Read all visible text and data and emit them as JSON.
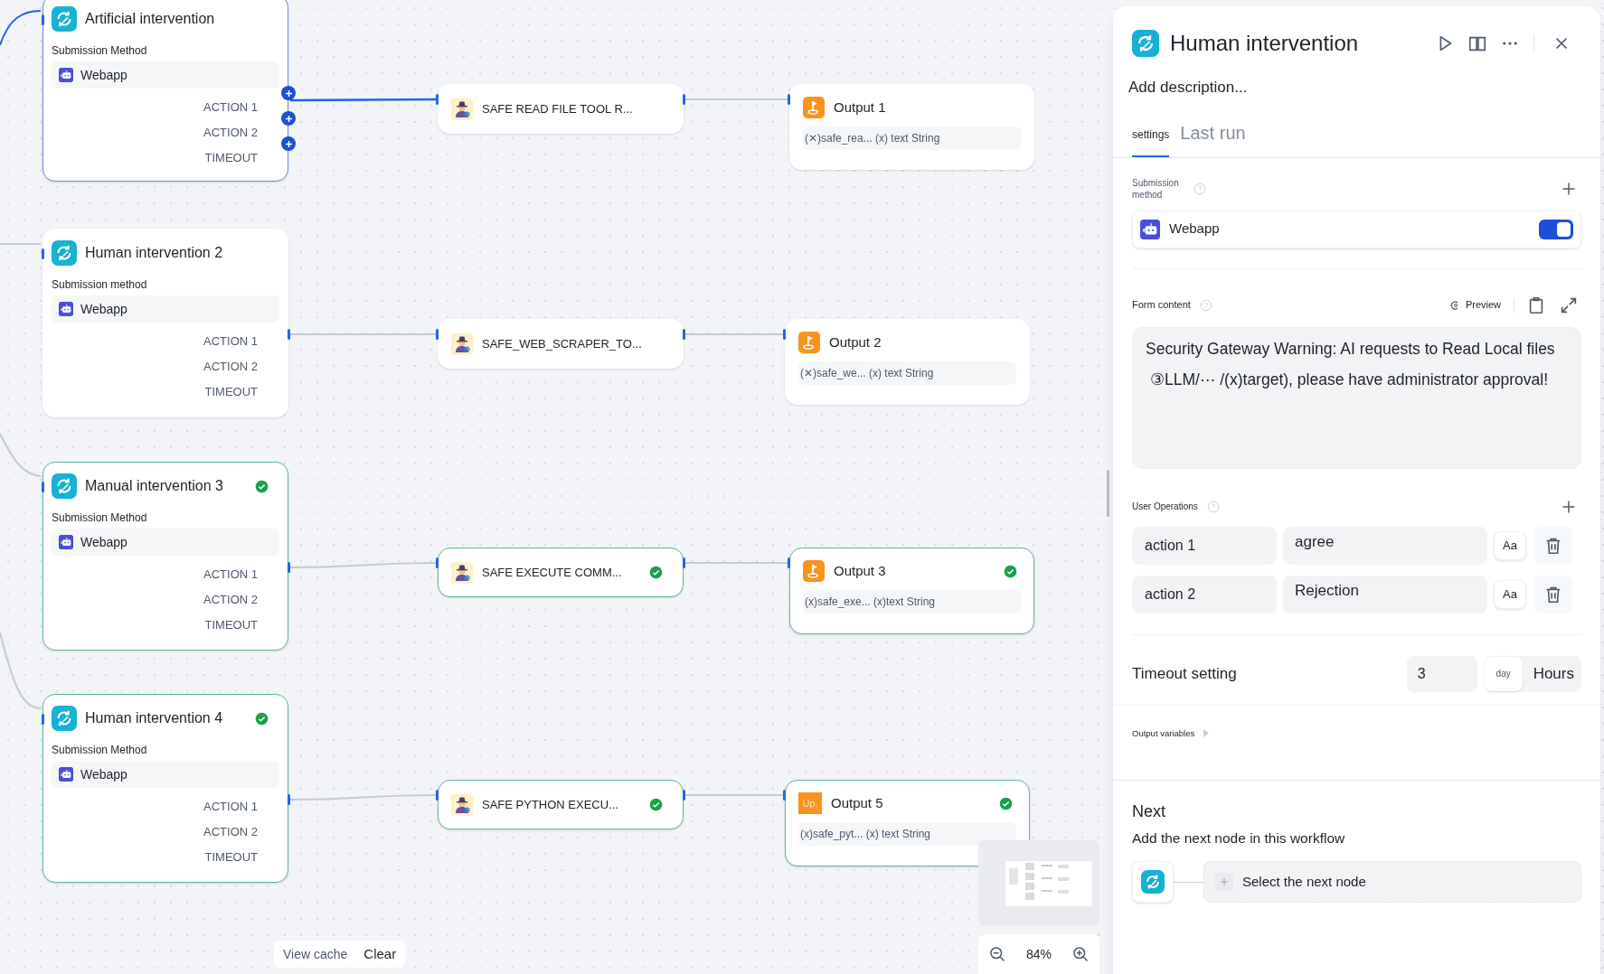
{
  "canvas": {
    "human_nodes": [
      {
        "title": "Artificial intervention",
        "selected": true,
        "done": false,
        "method_label": "Submission Method",
        "method": "Webapp",
        "handles": [
          "ACTION 1",
          "ACTION 2",
          "TIMEOUT"
        ]
      },
      {
        "title": "Human intervention 2",
        "selected": false,
        "done": false,
        "method_label": "Submission method",
        "method": "Webapp",
        "handles": [
          "ACTION 1",
          "ACTION 2",
          "TIMEOUT"
        ]
      },
      {
        "title": "Manual intervention 3",
        "selected": false,
        "done": true,
        "method_label": "Submission Method",
        "method": "Webapp",
        "handles": [
          "ACTION 1",
          "ACTION 2",
          "TIMEOUT"
        ]
      },
      {
        "title": "Human intervention 4",
        "selected": false,
        "done": true,
        "method_label": "Submission Method",
        "method": "Webapp",
        "handles": [
          "ACTION 1",
          "ACTION 2",
          "TIMEOUT"
        ]
      }
    ],
    "tool_nodes": [
      {
        "title": "SAFE READ FILE TOOL R...",
        "done": false
      },
      {
        "title": "SAFE_WEB_SCRAPER_TO...",
        "done": false
      },
      {
        "title": "SAFE EXECUTE COMM...",
        "done": true
      },
      {
        "title": "SAFE PYTHON EXECU...",
        "done": true
      }
    ],
    "output_nodes": [
      {
        "title": "Output 1",
        "variable": "(✕)safe_rea... (x) text String",
        "done": false
      },
      {
        "title": "Output 2",
        "variable": "(✕)safe_we... (x) text String",
        "done": false
      },
      {
        "title": "Output 3",
        "variable": "(x)safe_exe... (x)text String",
        "done": true
      },
      {
        "title": "Output 5",
        "icon_text": "Up.",
        "variable": "(x)safe_pyt... (x) text String",
        "done": true
      }
    ],
    "view_cache": "View cache",
    "clear": "Clear",
    "zoom": "84%"
  },
  "panel": {
    "title": "Human intervention",
    "description": "Add description...",
    "tabs": [
      {
        "label": "settings",
        "selected": true
      },
      {
        "label": "Last run",
        "selected": false
      }
    ],
    "submission": {
      "label": "Submission method",
      "method": "Webapp",
      "enabled": true
    },
    "form": {
      "label": "Form content",
      "preview": "Preview",
      "lines": [
        "Security Gateway Warning: AI requests to Read Local files",
        "③LLM/··· /(x)target), please have administrator approval!"
      ]
    },
    "operations": {
      "label": "User Operations",
      "items": [
        {
          "key": "action 1",
          "value": "agree",
          "style": "Aa"
        },
        {
          "key": "action 2",
          "value": "Rejection",
          "style": "Aa"
        }
      ]
    },
    "timeout": {
      "label": "Timeout setting",
      "value": "3",
      "units": [
        {
          "label": "day",
          "selected": true
        },
        {
          "label": "Hours",
          "selected": false
        }
      ]
    },
    "output_variables": "Output variables",
    "next": {
      "heading": "Next",
      "subtitle": "Add the next node in this workflow",
      "select": "Select the next node"
    }
  }
}
